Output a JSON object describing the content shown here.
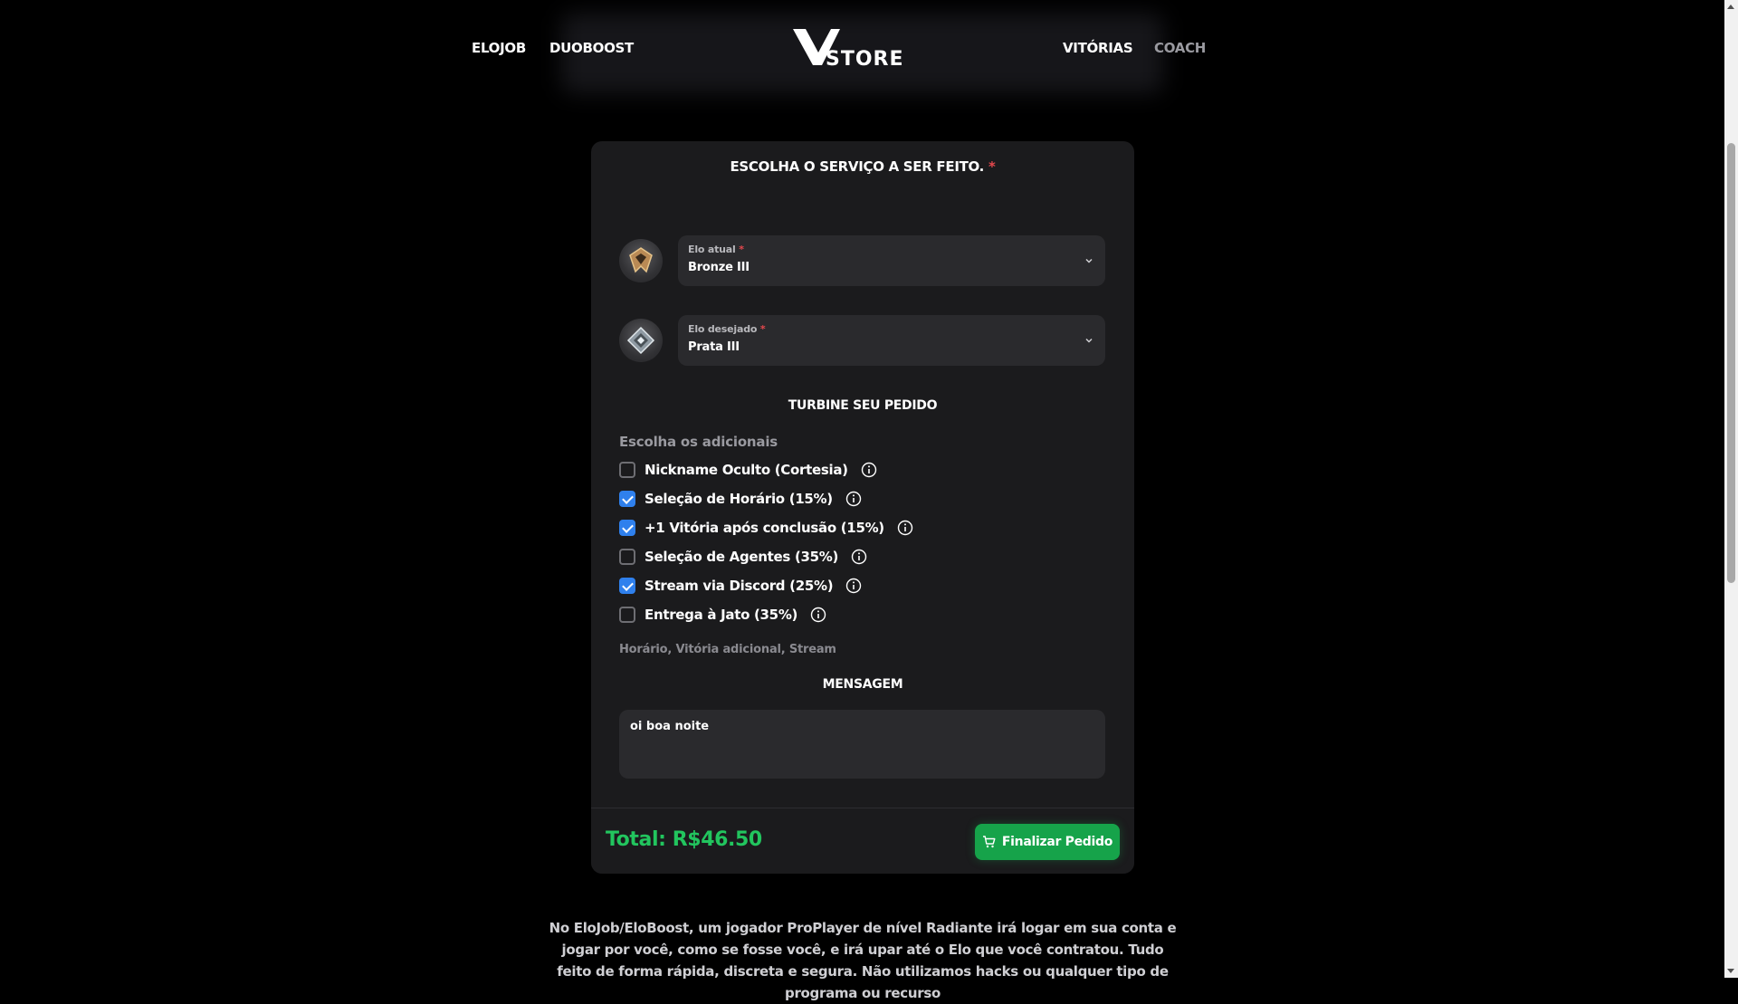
{
  "nav": {
    "left": [
      "ELOJOB",
      "DUOBOOST"
    ],
    "right": [
      "VITÓRIAS",
      "COACH"
    ],
    "logo_text": "STORE"
  },
  "form": {
    "title": "ESCOLHA O SERVIÇO A SER FEITO.",
    "required_mark": "*",
    "current_elo": {
      "label": "Elo atual",
      "value": "Bronze III",
      "icon": "bronze-rank-icon"
    },
    "desired_elo": {
      "label": "Elo desejado",
      "value": "Prata III",
      "icon": "silver-rank-icon"
    },
    "boost_title": "TURBINE SEU PEDIDO",
    "addons_label": "Escolha os adicionais",
    "addons": [
      {
        "label": "Nickname Oculto (Cortesia)",
        "checked": false
      },
      {
        "label": "Seleção de Horário (15%)",
        "checked": true
      },
      {
        "label": "+1 Vitória após conclusão (15%)",
        "checked": true
      },
      {
        "label": "Seleção de Agentes (35%)",
        "checked": false
      },
      {
        "label": "Stream via Discord (25%)",
        "checked": true
      },
      {
        "label": "Entrega à Jato (35%)",
        "checked": false
      }
    ],
    "selected_summary": "Horário, Vitória adicional, Stream",
    "message_title": "MENSAGEM",
    "message_value": "oi boa noite",
    "total": "Total: R$46.50",
    "checkout_label": "Finalizar Pedido"
  },
  "description": "No EloJob/EloBoost, um jogador ProPlayer de nível Radiante irá logar em sua conta e jogar por você, como se fosse você, e irá upar até o Elo que você contratou. Tudo feito de forma rápida, discreta e segura. Não utilizamos hacks ou qualquer tipo de programa ou recurso",
  "colors": {
    "accent_green": "#22c55e",
    "button_green": "#16a34a",
    "checkbox_blue": "#2f80ed",
    "required_red": "#e5484d"
  }
}
